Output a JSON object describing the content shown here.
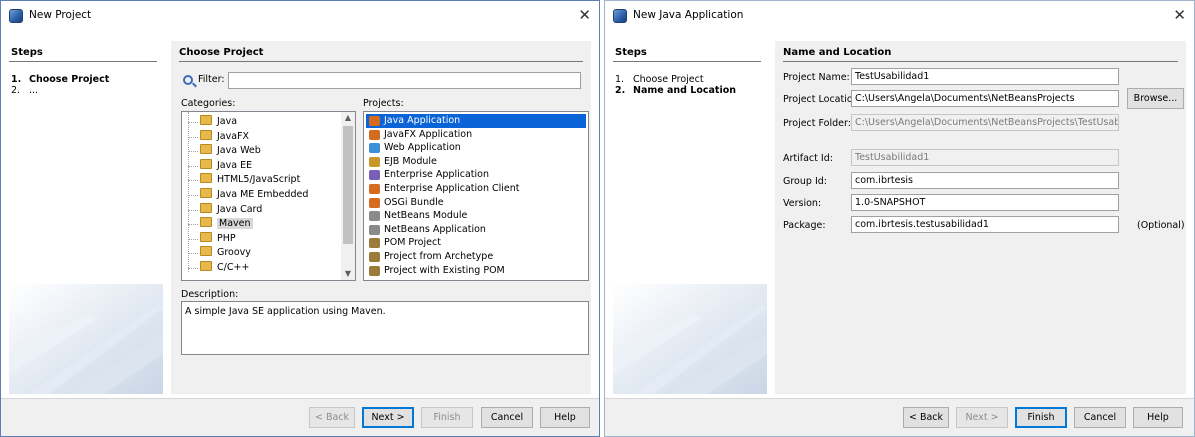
{
  "dialog1": {
    "title": "New Project",
    "steps": {
      "header": "Steps",
      "items": [
        {
          "num": "1.",
          "label": "Choose Project",
          "bold": true
        },
        {
          "num": "2.",
          "label": "...",
          "bold": false
        }
      ]
    },
    "content_header": "Choose Project",
    "filter_label": "Filter:",
    "filter_value": "",
    "categories_label": "Categories:",
    "categories": [
      "Java",
      "JavaFX",
      "Java Web",
      "Java EE",
      "HTML5/JavaScript",
      "Java ME Embedded",
      "Java Card",
      "Maven",
      "PHP",
      "Groovy",
      "C/C++"
    ],
    "selected_category": "Maven",
    "projects_label": "Projects:",
    "projects": [
      {
        "label": "Java Application",
        "icon": "java-app-icon",
        "color": "#d46b1f"
      },
      {
        "label": "JavaFX Application",
        "icon": "javafx-app-icon",
        "color": "#d46b1f"
      },
      {
        "label": "Web Application",
        "icon": "web-app-icon",
        "color": "#3a8fd8"
      },
      {
        "label": "EJB Module",
        "icon": "ejb-module-icon",
        "color": "#c8962b"
      },
      {
        "label": "Enterprise Application",
        "icon": "enterprise-app-icon",
        "color": "#7a5fb8"
      },
      {
        "label": "Enterprise Application Client",
        "icon": "enterprise-client-icon",
        "color": "#d46b1f"
      },
      {
        "label": "OSGi Bundle",
        "icon": "osgi-bundle-icon",
        "color": "#d46b1f"
      },
      {
        "label": "NetBeans Module",
        "icon": "netbeans-module-icon",
        "color": "#8a8a8a"
      },
      {
        "label": "NetBeans Application",
        "icon": "netbeans-app-icon",
        "color": "#8a8a8a"
      },
      {
        "label": "POM Project",
        "icon": "pom-project-icon",
        "color": "#9b7a3a"
      },
      {
        "label": "Project from Archetype",
        "icon": "archetype-project-icon",
        "color": "#9b7a3a"
      },
      {
        "label": "Project with Existing POM",
        "icon": "existing-pom-icon",
        "color": "#9b7a3a"
      }
    ],
    "selected_project": "Java Application",
    "description_label": "Description:",
    "description": "A simple Java SE application using Maven.",
    "buttons": {
      "back": "< Back",
      "next": "Next >",
      "finish": "Finish",
      "cancel": "Cancel",
      "help": "Help"
    }
  },
  "dialog2": {
    "title": "New Java Application",
    "steps": {
      "header": "Steps",
      "items": [
        {
          "num": "1.",
          "label": "Choose Project",
          "bold": false
        },
        {
          "num": "2.",
          "label": "Name and Location",
          "bold": true
        }
      ]
    },
    "content_header": "Name and Location",
    "fields": {
      "project_name": {
        "label": "Project Name:",
        "value": "TestUsabilidad1"
      },
      "project_location": {
        "label": "Project Location:",
        "value": "C:\\Users\\Angela\\Documents\\NetBeansProjects"
      },
      "project_folder": {
        "label": "Project Folder:",
        "value": "C:\\Users\\Angela\\Documents\\NetBeansProjects\\TestUsabilidad1"
      },
      "artifact_id": {
        "label": "Artifact Id:",
        "value": "TestUsabilidad1"
      },
      "group_id": {
        "label": "Group Id:",
        "value": "com.ibrtesis"
      },
      "version": {
        "label": "Version:",
        "value": "1.0-SNAPSHOT"
      },
      "package": {
        "label": "Package:",
        "value": "com.ibrtesis.testusabilidad1"
      }
    },
    "browse_label": "Browse...",
    "optional_label": "(Optional)",
    "buttons": {
      "back": "< Back",
      "next": "Next >",
      "finish": "Finish",
      "cancel": "Cancel",
      "help": "Help"
    }
  },
  "colors": {
    "selection": "#0a64d8",
    "default_button_border": "#0078d7",
    "panel_bg": "#f0f0f0"
  }
}
